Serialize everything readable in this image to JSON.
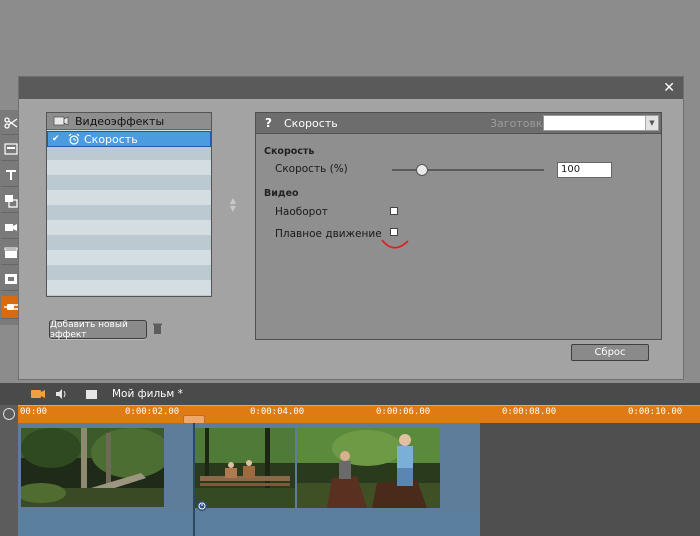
{
  "dialog": {
    "close_glyph": "✕",
    "effects_header": "Видеоэффекты",
    "selected_effect": "Скорость",
    "add_effect_button": "Добавить новый эффект",
    "reset_button": "Сброс"
  },
  "panel": {
    "help_glyph": "?",
    "title": "Скорость",
    "presets_label": "Заготовки",
    "presets_value": "",
    "section_speed": "Скорость",
    "speed_label": "Скорость (%)",
    "speed_value": "100",
    "speed_slider_level": 0.19,
    "section_video": "Видео",
    "reverse_label": "Наоборот",
    "smooth_label": "Плавное движение"
  },
  "toolbar_icons": [
    "scissors-icon",
    "titles-icon",
    "text-icon",
    "effects-icon",
    "camera-icon",
    "clapper-icon",
    "menu-icon",
    "plug-icon"
  ],
  "timeline": {
    "project_title": "Мой фильм *",
    "ticks": [
      "00:00",
      "0:00:02.00",
      "0:00:04.00",
      "0:00:06.00",
      "0:00:08.00",
      "0:00:10.00"
    ]
  },
  "colors": {
    "accent": "#e07a12",
    "selection": "#4a9be0",
    "annotation": "#e02020"
  }
}
